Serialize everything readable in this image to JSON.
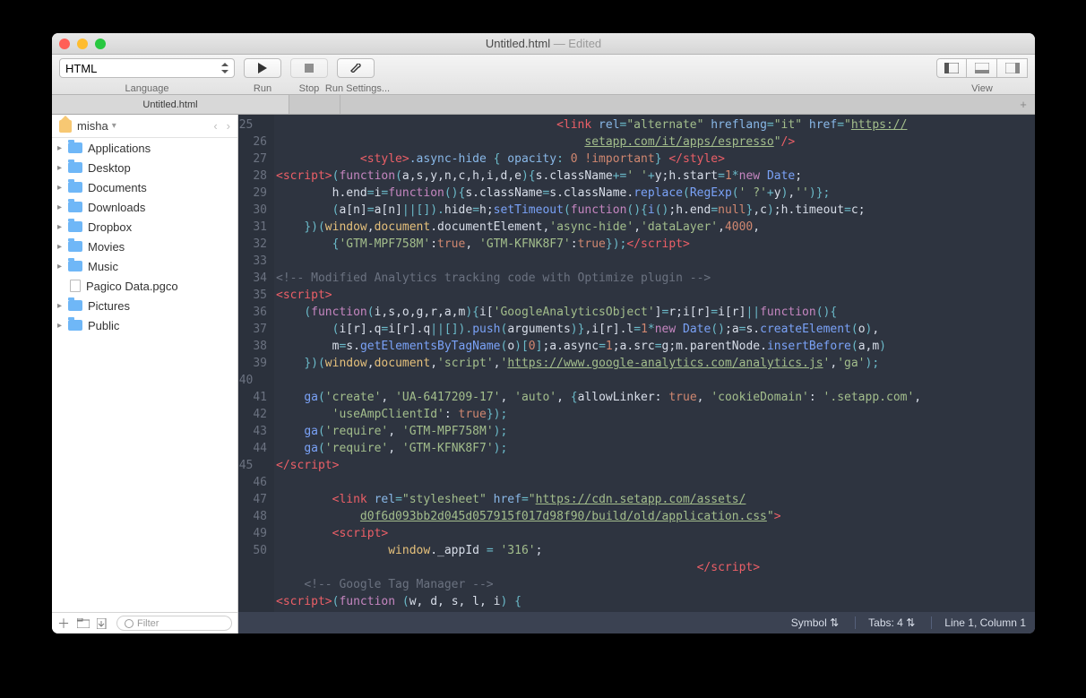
{
  "window": {
    "title": "Untitled.html",
    "edited": " — Edited"
  },
  "toolbar": {
    "language": "HTML",
    "language_label": "Language",
    "run": "Run",
    "stop": "Stop",
    "run_settings": "Run Settings...",
    "view": "View"
  },
  "tab": {
    "name": "Untitled.html",
    "plus": "+"
  },
  "sidebar": {
    "user": "misha",
    "items": [
      {
        "label": "Applications",
        "type": "folder"
      },
      {
        "label": "Desktop",
        "type": "folder"
      },
      {
        "label": "Documents",
        "type": "folder"
      },
      {
        "label": "Downloads",
        "type": "folder"
      },
      {
        "label": "Dropbox",
        "type": "folder"
      },
      {
        "label": "Movies",
        "type": "folder"
      },
      {
        "label": "Music",
        "type": "folder"
      },
      {
        "label": "Pagico Data.pgco",
        "type": "file"
      },
      {
        "label": "Pictures",
        "type": "folder"
      },
      {
        "label": "Public",
        "type": "folder"
      }
    ],
    "filter_placeholder": "Filter"
  },
  "status": {
    "symbol": "Symbol",
    "tabs": "Tabs: 4",
    "pos": "Line 1, Column 1"
  },
  "code": {
    "first_line": 25,
    "lines": [
      {
        "n": 25,
        "html": "                                        <span class='c-tag'>&lt;link</span> <span class='c-attr'>rel</span><span class='c-op'>=</span><span class='c-str'>\"alternate\"</span> <span class='c-attr'>hreflang</span><span class='c-op'>=</span><span class='c-str'>\"it\"</span> <span class='c-attr'>href</span><span class='c-op'>=</span><span class='c-str'>\"</span><span class='c-link'>https://</span>"
      },
      {
        "n": "",
        "html": "                                            <span class='c-link'>setapp.com/it/apps/espresso</span><span class='c-str'>\"</span><span class='c-tag'>/&gt;</span>"
      },
      {
        "n": 26,
        "html": "            <span class='c-tag'>&lt;style&gt;</span><span class='c-style'>.async-hide</span> <span class='c-op'>{</span> <span class='c-attr'>opacity</span><span class='c-op'>:</span> <span class='c-num'>0</span> <span class='c-num'>!important</span><span class='c-op'>}</span> <span class='c-tag'>&lt;/style&gt;</span>"
      },
      {
        "n": 27,
        "html": "<span class='c-tag'>&lt;script&gt;</span><span class='c-op'>(</span><span class='c-kw'>function</span><span class='c-op'>(</span>a,s,y,n,c,h,i,d,e<span class='c-op'>){</span>s.className<span class='c-op'>+=</span><span class='c-str'>' '</span><span class='c-op'>+</span>y;h.start<span class='c-op'>=</span><span class='c-num'>1</span><span class='c-op'>*</span><span class='c-kw'>new</span> <span class='c-fn'>Date</span>;"
      },
      {
        "n": 28,
        "html": "        h.end<span class='c-op'>=</span>i<span class='c-op'>=</span><span class='c-kw'>function</span><span class='c-op'>(){</span>s.className<span class='c-op'>=</span>s.className.<span class='c-fn'>replace</span><span class='c-op'>(</span><span class='c-fn'>RegExp</span><span class='c-op'>(</span><span class='c-str'>' ?'</span><span class='c-op'>+</span>y<span class='c-op'>)</span>,<span class='c-str'>''</span><span class='c-op'>)};</span>"
      },
      {
        "n": 29,
        "html": "        <span class='c-op'>(</span>a[n]<span class='c-op'>=</span>a[n]<span class='c-op'>||[]).</span>hide<span class='c-op'>=</span>h;<span class='c-fn'>setTimeout</span><span class='c-op'>(</span><span class='c-kw'>function</span><span class='c-op'>(){</span><span class='c-fn'>i</span><span class='c-op'>()</span>;h.end<span class='c-op'>=</span><span class='c-null'>null</span><span class='c-op'>}</span>,c<span class='c-op'>)</span>;h.timeout<span class='c-op'>=</span>c;"
      },
      {
        "n": 30,
        "html": "    <span class='c-op'>})(</span><span class='c-prop'>window</span>,<span class='c-prop'>document</span>.documentElement,<span class='c-str'>'async-hide'</span>,<span class='c-str'>'dataLayer'</span>,<span class='c-num'>4000</span>,"
      },
      {
        "n": 31,
        "html": "        <span class='c-op'>{</span><span class='c-str'>'GTM-MPF758M'</span>:<span class='c-bool'>true</span>, <span class='c-str'>'GTM-KFNK8F7'</span>:<span class='c-bool'>true</span><span class='c-op'>});</span><span class='c-tag'>&lt;/script&gt;</span>"
      },
      {
        "n": 32,
        "html": ""
      },
      {
        "n": 33,
        "html": "<span class='c-cm'>&lt;!-- Modified Analytics tracking code with Optimize plugin --&gt;</span>"
      },
      {
        "n": 34,
        "html": "<span class='c-tag'>&lt;script&gt;</span>"
      },
      {
        "n": 35,
        "html": "    <span class='c-op'>(</span><span class='c-kw'>function</span><span class='c-op'>(</span>i,s,o,g,r,a,m<span class='c-op'>){</span>i[<span class='c-str'>'GoogleAnalyticsObject'</span>]<span class='c-op'>=</span>r;i[r]<span class='c-op'>=</span>i[r]<span class='c-op'>||</span><span class='c-kw'>function</span><span class='c-op'>(){</span>"
      },
      {
        "n": 36,
        "html": "        <span class='c-op'>(</span>i[r].q<span class='c-op'>=</span>i[r].q<span class='c-op'>||[]).</span><span class='c-fn'>push</span><span class='c-op'>(</span>arguments<span class='c-op'>)}</span>,i[r].l<span class='c-op'>=</span><span class='c-num'>1</span><span class='c-op'>*</span><span class='c-kw'>new</span> <span class='c-fn'>Date</span><span class='c-op'>()</span>;a<span class='c-op'>=</span>s.<span class='c-fn'>createElement</span><span class='c-op'>(</span>o<span class='c-op'>)</span>,"
      },
      {
        "n": 37,
        "html": "        m<span class='c-op'>=</span>s.<span class='c-fn'>getElementsByTagName</span><span class='c-op'>(</span>o<span class='c-op'>)[</span><span class='c-num'>0</span><span class='c-op'>]</span>;a.async<span class='c-op'>=</span><span class='c-num'>1</span>;a.src<span class='c-op'>=</span>g;m.parentNode.<span class='c-fn'>insertBefore</span><span class='c-op'>(</span>a,m<span class='c-op'>)</span>"
      },
      {
        "n": 38,
        "html": "    <span class='c-op'>})(</span><span class='c-prop'>window</span>,<span class='c-prop'>document</span>,<span class='c-str'>'script'</span>,<span class='c-str'>'</span><span class='c-link'>https://www.google-analytics.com/analytics.js</span><span class='c-str'>'</span>,<span class='c-str'>'ga'</span><span class='c-op'>);</span>"
      },
      {
        "n": 39,
        "html": ""
      },
      {
        "n": 40,
        "html": "    <span class='c-fn'>ga</span><span class='c-op'>(</span><span class='c-str'>'create'</span>, <span class='c-str'>'UA-6417209-17'</span>, <span class='c-str'>'auto'</span>, <span class='c-op'>{</span>allowLinker: <span class='c-bool'>true</span>, <span class='c-str'>'cookieDomain'</span>: <span class='c-str'>'.setapp.com'</span>,"
      },
      {
        "n": "",
        "html": "        <span class='c-str'>'useAmpClientId'</span>: <span class='c-bool'>true</span><span class='c-op'>});</span>"
      },
      {
        "n": 41,
        "html": "    <span class='c-fn'>ga</span><span class='c-op'>(</span><span class='c-str'>'require'</span>, <span class='c-str'>'GTM-MPF758M'</span><span class='c-op'>);</span>"
      },
      {
        "n": 42,
        "html": "    <span class='c-fn'>ga</span><span class='c-op'>(</span><span class='c-str'>'require'</span>, <span class='c-str'>'GTM-KFNK8F7'</span><span class='c-op'>);</span>"
      },
      {
        "n": 43,
        "html": "<span class='c-tag'>&lt;/script&gt;</span>"
      },
      {
        "n": 44,
        "html": ""
      },
      {
        "n": 45,
        "html": "        <span class='c-tag'>&lt;link</span> <span class='c-attr'>rel</span><span class='c-op'>=</span><span class='c-str'>\"stylesheet\"</span> <span class='c-attr'>href</span><span class='c-op'>=</span><span class='c-str'>\"</span><span class='c-link'>https://cdn.setapp.com/assets/</span>"
      },
      {
        "n": "",
        "html": "            <span class='c-link'>d0f6d093bb2d045d057915f017d98f90/build/old/application.css</span><span class='c-str'>\"</span><span class='c-tag'>&gt;</span>"
      },
      {
        "n": 46,
        "html": "        <span class='c-tag'>&lt;script&gt;</span>"
      },
      {
        "n": 47,
        "html": "                <span class='c-prop'>window</span>._appId <span class='c-op'>=</span> <span class='c-str'>'316'</span>;"
      },
      {
        "n": 48,
        "html": "                                                            <span class='c-tag'>&lt;/script&gt;</span>"
      },
      {
        "n": 49,
        "html": "    <span class='c-cm'>&lt;!-- Google Tag Manager --&gt;</span>"
      },
      {
        "n": 50,
        "html": "<span class='c-tag'>&lt;script&gt;</span><span class='c-op'>(</span><span class='c-kw'>function</span> <span class='c-op'>(</span>w, d, s, l, i<span class='c-op'>)</span> <span class='c-op'>{</span>"
      }
    ]
  }
}
